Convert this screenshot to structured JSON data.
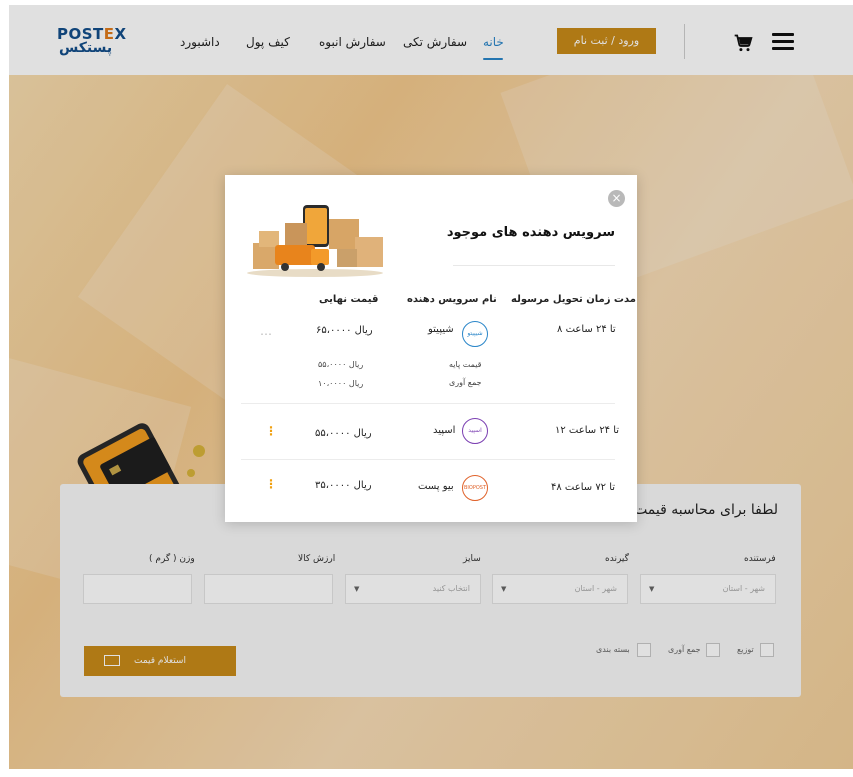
{
  "header": {
    "logo_en": "POSTEX",
    "logo_fa": "پستکس",
    "nav": [
      "خانه",
      "سفارش تکی",
      "سفارش انبوه",
      "کیف پول",
      "داشبورد"
    ],
    "login_label": "ورود / ثبت نام"
  },
  "calculator": {
    "title": "لطفا برای محاسبه قیمت",
    "fields": [
      {
        "label": "فرستنده",
        "placeholder": "شهر - استان"
      },
      {
        "label": "گیرنده",
        "placeholder": "شهر - استان"
      },
      {
        "label": "سایز",
        "placeholder": "انتخاب کنید"
      },
      {
        "label": "ارزش کالا",
        "placeholder": ""
      },
      {
        "label": "وزن ( گرم )",
        "placeholder": ""
      }
    ],
    "options": [
      "توزیع",
      "جمع آوری",
      "بسته بندی"
    ],
    "inquiry_label": "استعلام قیمت"
  },
  "modal": {
    "title": "سرویس دهنده های موجود",
    "columns": [
      "مدت زمان تحویل مرسوله",
      "نام سرویس دهنده",
      "قیمت نهایی"
    ],
    "rows": [
      {
        "time": "۸ تا ۲۴ ساعت",
        "provider": "شیپیتو",
        "provider_logo": "شیپیتو",
        "price": "۶۵،۰۰۰۰ ریال",
        "details": [
          {
            "label": "قیمت پایه",
            "value": "۵۵،۰۰۰۰ ریال"
          },
          {
            "label": "جمع آوری",
            "value": "۱۰،۰۰۰۰ ریال"
          }
        ],
        "more_icon": "…",
        "accent": "#2a86c9"
      },
      {
        "time": "۱۲ تا ۲۴ ساعت",
        "provider": "اسپید",
        "provider_logo": "اسپید",
        "price": "۵۵،۰۰۰۰ ریال",
        "more_icon": "⋮",
        "accent": "#7b3fb2"
      },
      {
        "time": "۴۸ تا ۷۲ ساعت",
        "provider": "بیو پست",
        "provider_logo": "BIOPOST",
        "price": "۳۵،۰۰۰۰ ریال",
        "more_icon": "⋮",
        "accent": "#e0622a"
      }
    ],
    "close_icon": "×"
  },
  "colors": {
    "accent": "#c88a18",
    "link": "#2a86c9",
    "kebab": "#f0a010"
  }
}
